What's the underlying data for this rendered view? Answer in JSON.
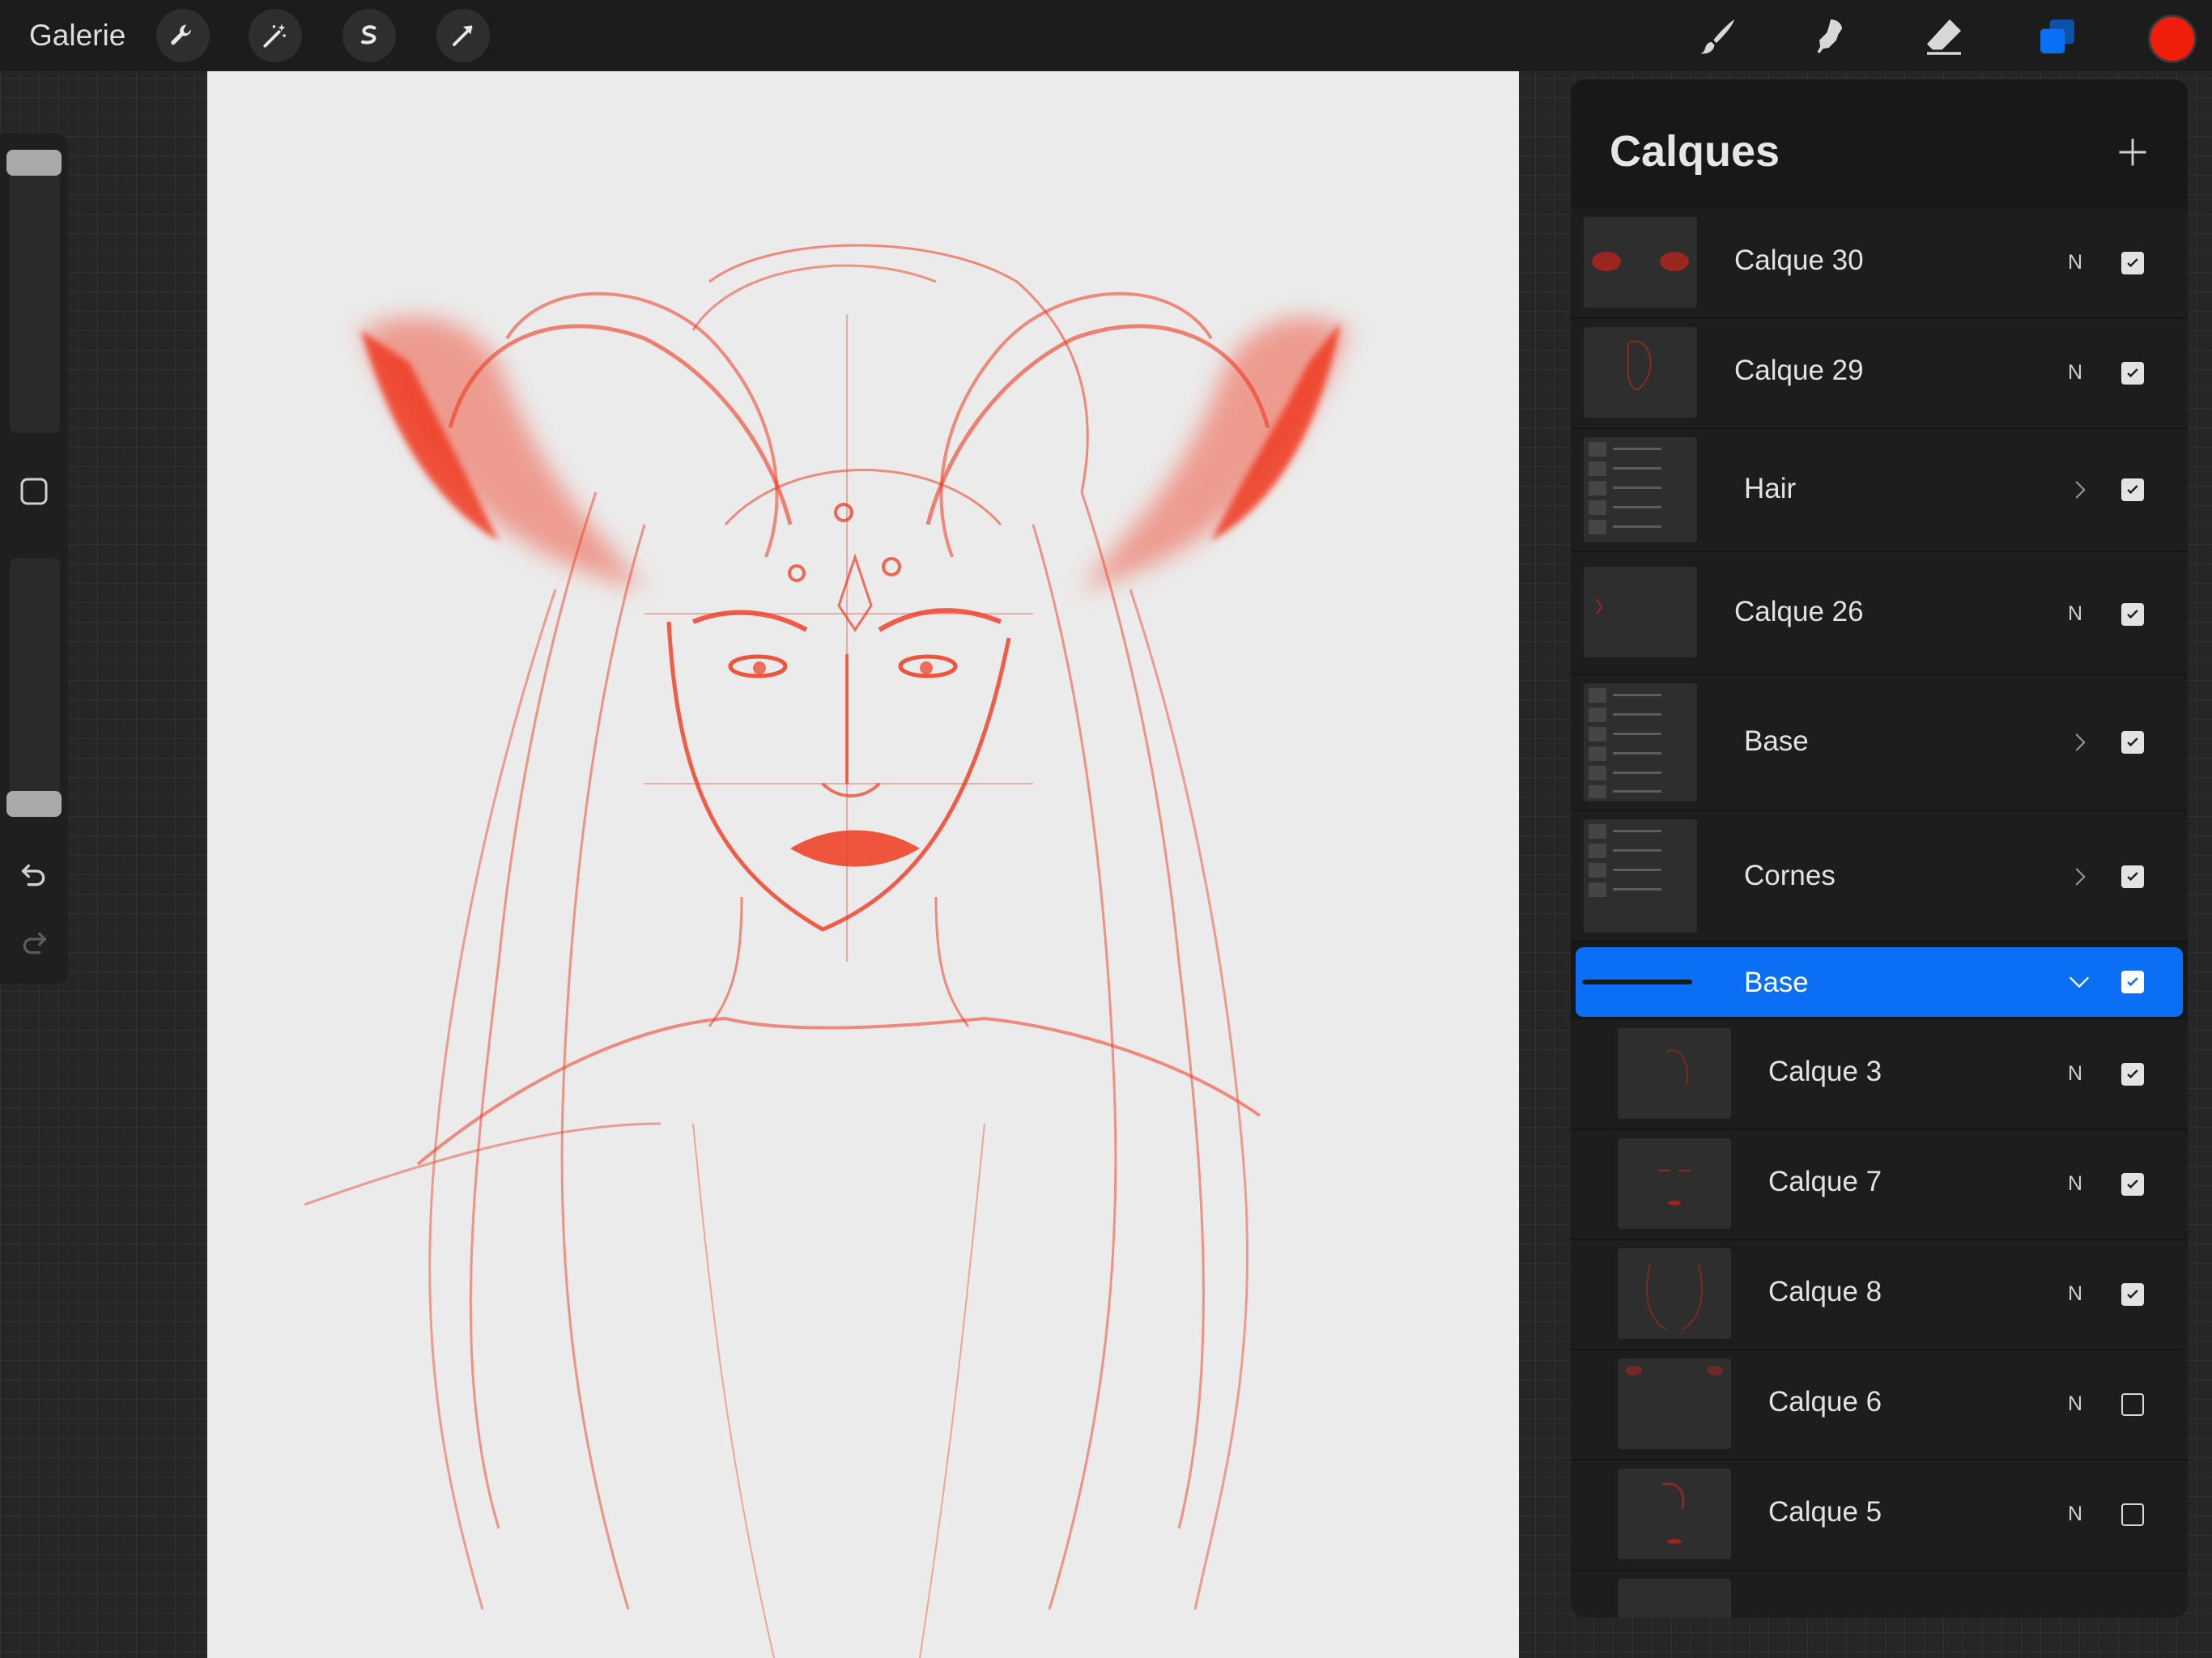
{
  "topbar": {
    "gallery_label": "Galerie",
    "tools_left": [
      "wrench-icon",
      "magic-wand-icon",
      "selection-icon",
      "transform-icon"
    ],
    "tools_right": [
      "brush-icon",
      "smudge-icon",
      "eraser-icon",
      "layers-icon"
    ],
    "active_color": "#f01d0d",
    "active_tool_color": "#0b6ff5"
  },
  "sidebar": {
    "brush_size_level": 0.0,
    "opacity_level": 0.0,
    "icons": [
      "modify-square-icon",
      "undo-icon",
      "redo-icon"
    ]
  },
  "canvas": {
    "stroke_color": "#f0391f",
    "background": "#ebebeb"
  },
  "layers": {
    "title": "Calques",
    "add_icon": "plus-icon",
    "items": [
      {
        "label": "Calque 30",
        "blend": "N",
        "visible": true,
        "group": false
      },
      {
        "label": "Calque 29",
        "blend": "N",
        "visible": true,
        "group": false
      },
      {
        "label": "Hair",
        "blend": "",
        "visible": true,
        "group": true,
        "expanded": false
      },
      {
        "label": "Calque 26",
        "blend": "N",
        "visible": true,
        "group": false
      },
      {
        "label": "Base",
        "blend": "",
        "visible": true,
        "group": true,
        "expanded": false
      },
      {
        "label": "Cornes",
        "blend": "",
        "visible": true,
        "group": true,
        "expanded": false
      },
      {
        "label": "Base",
        "blend": "",
        "visible": true,
        "group": true,
        "expanded": true,
        "selected": true
      },
      {
        "label": "Calque 3",
        "blend": "N",
        "visible": true,
        "group": false,
        "indent": true
      },
      {
        "label": "Calque 7",
        "blend": "N",
        "visible": true,
        "group": false,
        "indent": true
      },
      {
        "label": "Calque 8",
        "blend": "N",
        "visible": true,
        "group": false,
        "indent": true
      },
      {
        "label": "Calque 6",
        "blend": "N",
        "visible": false,
        "group": false,
        "indent": true
      },
      {
        "label": "Calque 5",
        "blend": "N",
        "visible": false,
        "group": false,
        "indent": true
      }
    ]
  }
}
